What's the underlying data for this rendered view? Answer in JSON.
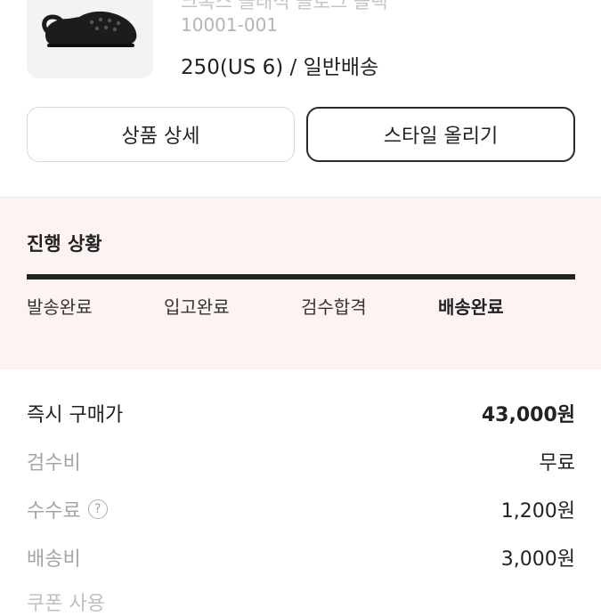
{
  "product": {
    "name": "크록스 클래식 클로그 블랙",
    "code": "10001-001",
    "size_shipping": "250(US 6) / 일반배송",
    "image_icon": "clog-shoe-icon"
  },
  "actions": {
    "detail_label": "상품 상세",
    "style_label": "스타일 올리기"
  },
  "progress": {
    "title": "진행 상황",
    "steps": [
      "발송완료",
      "입고완료",
      "검수합격",
      "배송완료"
    ],
    "current_step_index": 3,
    "completion": 1.0
  },
  "fees": {
    "instant_price": {
      "label": "즉시 구매가",
      "value": "43,000원"
    },
    "inspection": {
      "label": "검수비",
      "value": "무료"
    },
    "commission": {
      "label": "수수료",
      "value": "1,200원",
      "help_icon": "question-circle-icon"
    },
    "shipping": {
      "label": "배송비",
      "value": "3,000원"
    },
    "coupon": {
      "label": "쿠폰 사용"
    }
  },
  "colors": {
    "progress_bg": "#fdf3f2",
    "progress_fill": "#222222",
    "muted_text": "#a5a5a5"
  }
}
